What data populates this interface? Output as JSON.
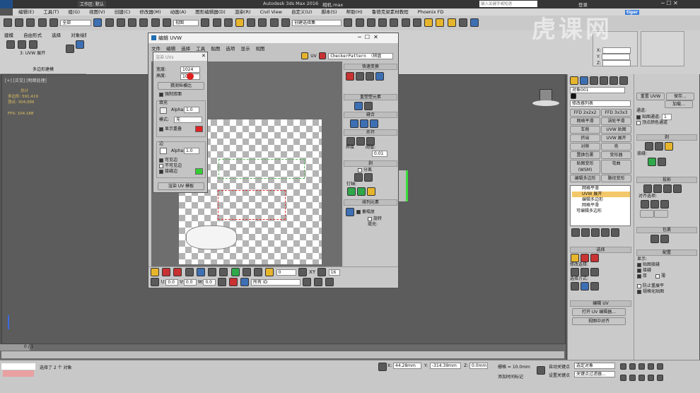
{
  "app": {
    "title": "Autodesk 3ds Max 2016",
    "file": "相机.max",
    "search_placeholder": "键入关键字或短语",
    "login": "登录",
    "workspace": "工作区: 默认",
    "civil_view": "Civil View"
  },
  "menu": [
    "编辑(E)",
    "工具(T)",
    "组(G)",
    "视图(V)",
    "创建(C)",
    "修改器(M)",
    "动画(A)",
    "图形编辑器(D)",
    "渲染(R)",
    "Civil View",
    "自定义(U)",
    "脚本(S)",
    "帮助(H)",
    "鲁德克梁素材教程",
    "Phoenix FD"
  ],
  "toolbar": {
    "filter": "全部",
    "view": "视图",
    "selection_set": "创建选择集"
  },
  "ribbon": {
    "tabs": [
      "建模",
      "自由形式",
      "选择",
      "对象绘制",
      "填充"
    ],
    "group_label": "3: UVW 展开",
    "poly_label": "多边形建模"
  },
  "viewport": {
    "label": "[+] [正交] [明暗处理]",
    "stats_title": "总计",
    "poly_label": "多边形: 591,419",
    "vert_label": "顶点: 304,089",
    "fps_label": "FPS: 104.188"
  },
  "uvw_window": {
    "title": "编辑 UVW",
    "menu": [
      "文件",
      "编辑",
      "选择",
      "工具",
      "贴图",
      "选项",
      "显示",
      "视图"
    ],
    "uv_label": "UV",
    "checker": "CheckerPattern （棋盘",
    "bottom": {
      "u_label": "U:",
      "u_val": "0.0",
      "v_label": "V:",
      "v_val": "0.0",
      "w_label": "W:",
      "w_val": "0.0",
      "filter": "所有 ID",
      "xy": "XY",
      "num1": "0",
      "num2": "16"
    }
  },
  "render_dialog": {
    "title": "渲染 UVs",
    "width_label": "宽度:",
    "width_val": "1024",
    "height_label": "高度:",
    "height_val": "1024",
    "guess_button": "猜测纵横比",
    "force_button": "强制双面",
    "fill_group": "填充",
    "fill_alpha_label": "Alpha:",
    "fill_alpha_val": "1.0",
    "mode_label": "模式:",
    "mode_val": "无",
    "overlap": "显示重叠",
    "edge_group": "边",
    "edge_alpha_label": "Alpha:",
    "edge_alpha_val": "1.0",
    "visible_edges": "可见边",
    "invisible_edges": "不可见边",
    "seam_edges": "接缝边",
    "render_button": "渲染 UV 模板",
    "colors": {
      "overlap": "#dd2222",
      "seam": "#33cc33"
    }
  },
  "uvw_side": {
    "quick": "快速变换",
    "reshape": "重塑塑元素",
    "stitch": "缝合",
    "explode": "炸开",
    "weld": "焊接",
    "threshold_label": "阈值:",
    "threshold_val": "0.01",
    "peel": "剥",
    "detach": "分离",
    "pin": "钉轴:",
    "arrange": "排列元素",
    "rescale": "重缩放",
    "rotate": "旋转",
    "fill_label": "填充:"
  },
  "cmd_panel": {
    "object_name": "对象001",
    "modifier_list": "修改器列表",
    "buttons": [
      "FFD 2x2x2",
      "FFD 3x3x3",
      "网格平滑",
      "涡轮平滑",
      "车削",
      "UVW 贴图",
      "挤出",
      "UVW 展开",
      "对称",
      "壳",
      "置换包裹",
      "变形器",
      "贴图变形(WSM)",
      "弯曲",
      "编辑多边形",
      "路径变形"
    ],
    "stack": [
      "网格平滑",
      "UVW 展开",
      "编辑多边形",
      "网格平滑",
      "可编辑多边形"
    ],
    "select_hdr": "选择",
    "modify_select": "修改选择:",
    "select_by": "选择方式:",
    "edit_uv": "编辑 UV",
    "open_editor": "打开 UV 编辑器...",
    "view_align": "视图中对齐"
  },
  "right_panel": {
    "reset_uvw": "重置 UVW",
    "save": "保存...",
    "load": "加载...",
    "channel": "通道:",
    "map_channel": "贴图通道:",
    "map_channel_val": "1",
    "vertex_color": "顶点颜色通道",
    "peel": "剥",
    "seams": "接缝:",
    "project": "投影",
    "align_opts": "对齐选项:",
    "wrap": "包裹",
    "config": "配置",
    "display": "显示:",
    "display_opts": [
      "贴图接缝",
      "接缝",
      "厚",
      "薄"
    ],
    "prevent": "防止重展平",
    "normalize": "规格化贴图"
  },
  "coord": {
    "x": "X:",
    "y": "Y:",
    "z": "Z:"
  },
  "timeline": {
    "frame": "0 / 1"
  },
  "status": {
    "selected": "选择了 2 个 对象",
    "x_val": "44.28mm",
    "y_val": "-314.39mm",
    "z_val": "0.0mm",
    "grid": "栅格 = 10.0mm",
    "auto_key": "自动关键点",
    "set_key": "设置关键点",
    "selected_label": "选定对象",
    "add_time": "添加时间标记",
    "key_filter": "关键点过滤器..."
  },
  "watermark": {
    "brand": "虎课网",
    "small": "tiger"
  }
}
